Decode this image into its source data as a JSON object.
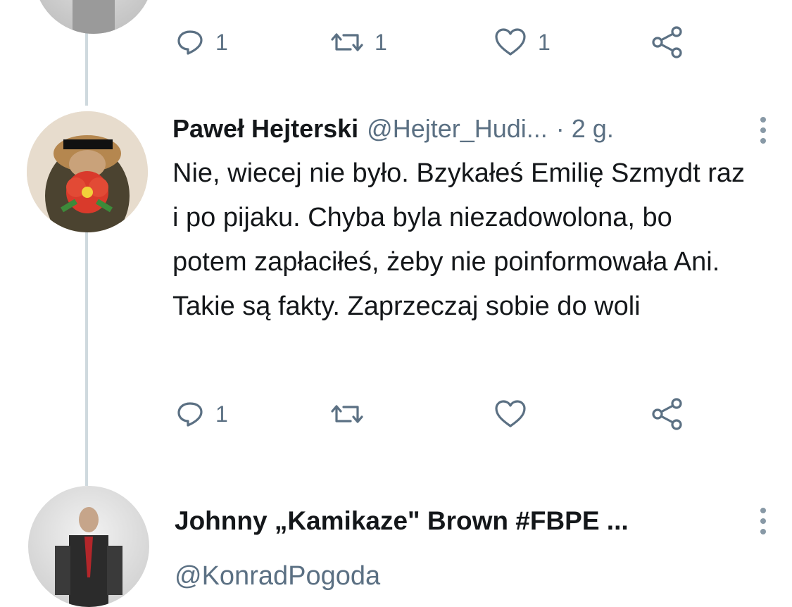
{
  "top_actions": {
    "reply_count": "1",
    "retweet_count": "1",
    "like_count": "1"
  },
  "tweet": {
    "author_name": "Paweł Hejterski",
    "author_handle": "@Hejter_Hudi...",
    "time": "· 2 g.",
    "text": "Nie, wiecej nie było. Bzykałeś Emilię Szmydt raz i po pijaku. Chyba byla niezadowolona, bo potem zapłaciłeś, żeby nie poinformowała Ani. Takie są fakty. Zaprzeczaj sobie do woli",
    "reply_count": "1",
    "retweet_count": "",
    "like_count": ""
  },
  "next_tweet": {
    "author_name": "Johnny „Kamikaze\" Brown #FBPE ...",
    "author_handle": "@KonradPogoda"
  },
  "colors": {
    "action_gray": "#5b7083",
    "thread_line": "#cfd9de",
    "text": "#14171a"
  },
  "icons": [
    "reply-icon",
    "retweet-icon",
    "like-icon",
    "share-icon",
    "more-options-icon"
  ]
}
